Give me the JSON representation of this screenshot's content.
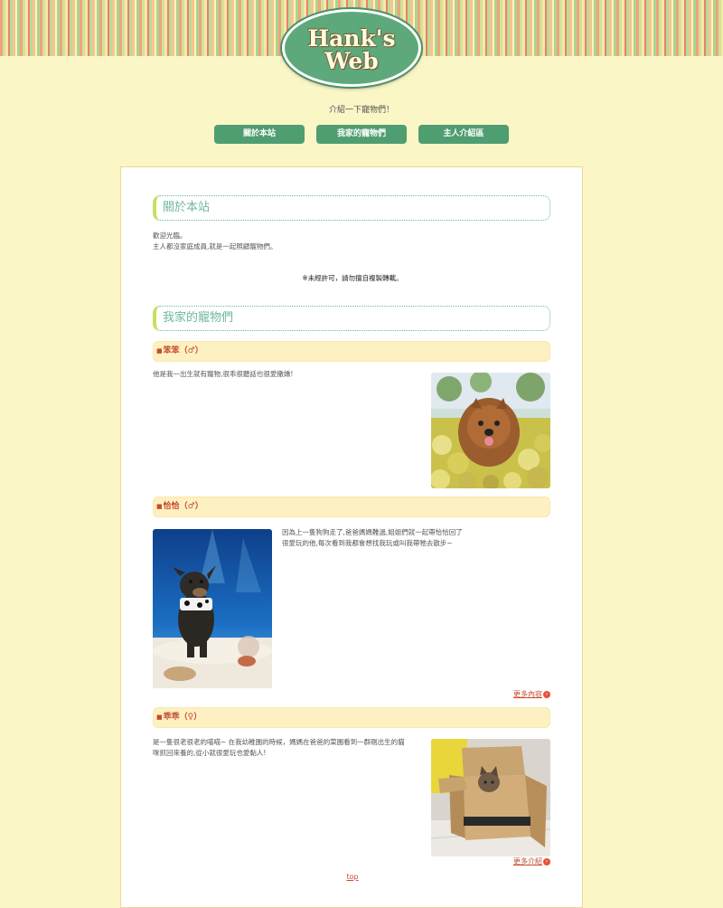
{
  "header": {
    "logo_line1": "Hank's",
    "logo_line2": "Web",
    "tagline": "介紹一下寵物們！"
  },
  "nav": [
    {
      "label": "關於本站"
    },
    {
      "label": "我家的寵物們"
    },
    {
      "label": "主人介紹區"
    }
  ],
  "about": {
    "heading": "關於本站",
    "line1": "歡迎光臨。",
    "line2": "主人都沒家庭成員,就是一起照顧寵物們。",
    "notice": "※未經許可，請勿擅自複製轉載。"
  },
  "pets": {
    "heading": "我家的寵物們",
    "items": [
      {
        "name": "笨笨",
        "gender": "（♂）",
        "description": "他是我一出生就有寵物,很乖很聽話也很愛撒嬌!"
      },
      {
        "name": "恰恰",
        "gender": "（♂）",
        "description_line1": "因為上一隻狗狗走了,爸爸媽媽難過,姐姐們就一起帶恰恰回了",
        "description_line2": "很愛玩的他,每次看到我都會想找我玩或叫我帶牠去散步~",
        "more_label": "更多內容"
      },
      {
        "name": "乖乖",
        "gender": "（♀）",
        "description_line1": "是一隻很老很老的喵喵~ 在我幼稚園的時候，媽媽在爸爸的菜園看到一群剛出生的貓",
        "description_line2": "咪抓回來養的,從小就很愛玩也愛黏人!",
        "more_label": "更多介紹"
      }
    ]
  },
  "footer": {
    "top_label": "top"
  },
  "colors": {
    "page_bg": "#fbf6c5",
    "nav_green": "#4f9e72",
    "accent_red": "#c84a2d",
    "heading_teal": "#6fb89a"
  }
}
